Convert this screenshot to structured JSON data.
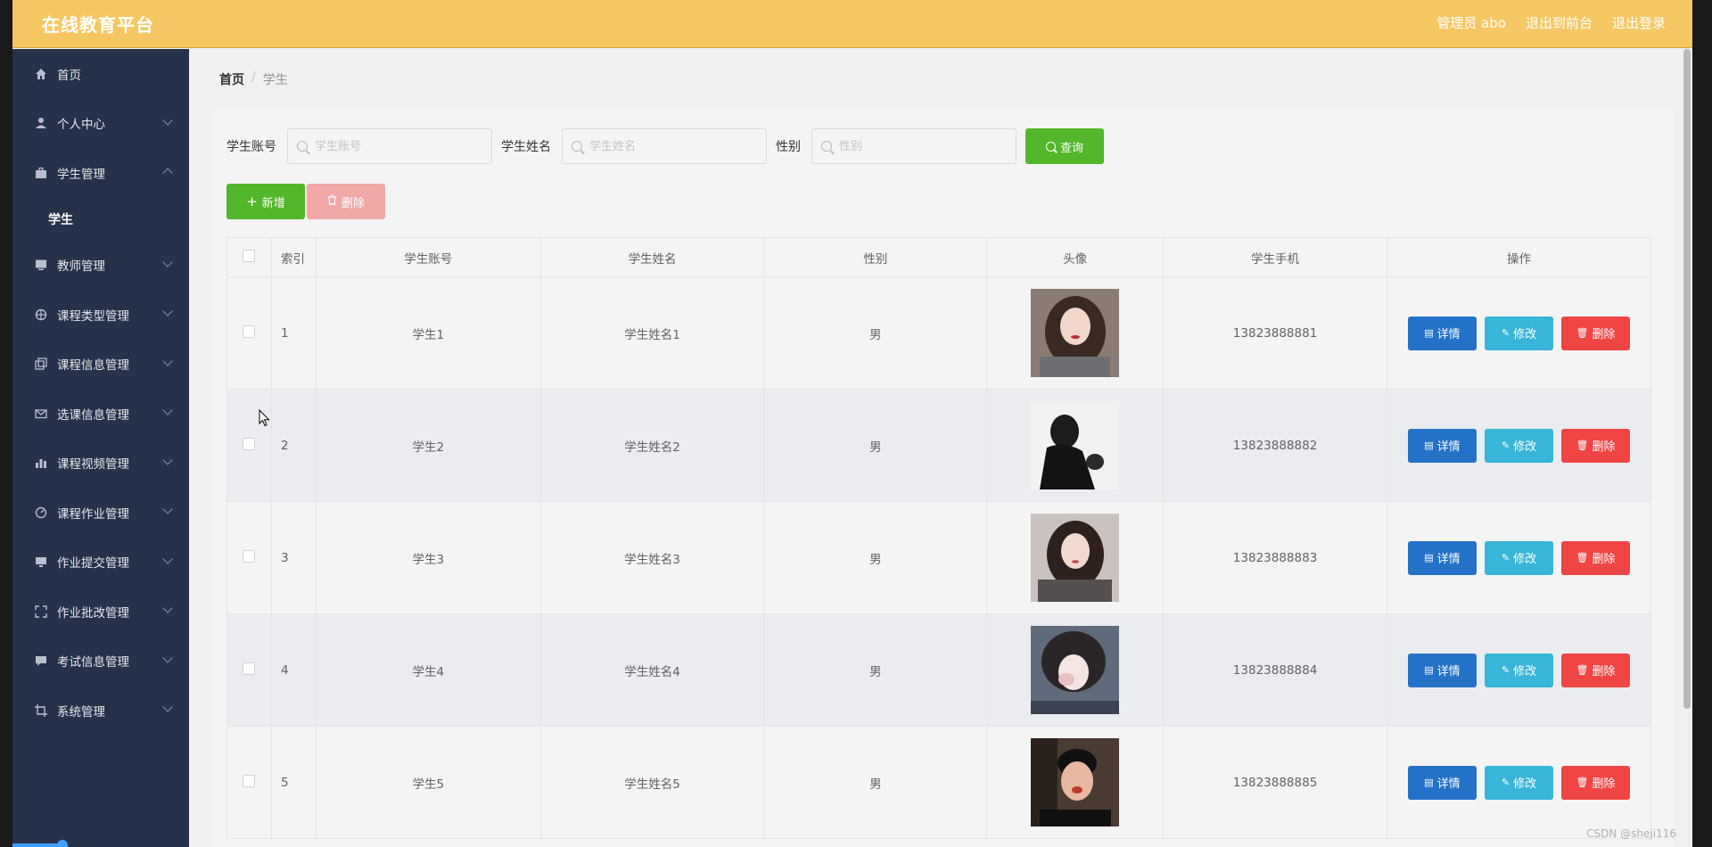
{
  "topbar": {
    "brand": "在线教育平台",
    "admin": "管理员 abo",
    "to_front": "退出到前台",
    "logout": "退出登录"
  },
  "sidebar": {
    "items": [
      {
        "label": "首页",
        "icon": "home-icon"
      },
      {
        "label": "个人中心",
        "icon": "user-icon"
      },
      {
        "label": "学生管理",
        "icon": "briefcase-icon"
      },
      {
        "label": "学生",
        "icon": ""
      },
      {
        "label": "教师管理",
        "icon": "monitor-icon"
      },
      {
        "label": "课程类型管理",
        "icon": "compass-icon"
      },
      {
        "label": "课程信息管理",
        "icon": "copy-icon"
      },
      {
        "label": "选课信息管理",
        "icon": "mail-icon"
      },
      {
        "label": "课程视频管理",
        "icon": "bar-chart-icon"
      },
      {
        "label": "课程作业管理",
        "icon": "gauge-icon"
      },
      {
        "label": "作业提交管理",
        "icon": "screen-icon"
      },
      {
        "label": "作业批改管理",
        "icon": "fullscreen-icon"
      },
      {
        "label": "考试信息管理",
        "icon": "message-icon"
      },
      {
        "label": "系统管理",
        "icon": "crop-icon"
      }
    ]
  },
  "breadcrumb": {
    "home": "首页",
    "sep": "/",
    "current": "学生"
  },
  "search": {
    "account_label": "学生账号",
    "account_placeholder": "学生账号",
    "name_label": "学生姓名",
    "name_placeholder": "学生姓名",
    "gender_label": "性别",
    "gender_placeholder": "性别",
    "query": "查询"
  },
  "actions": {
    "add": "新增",
    "delete": "删除"
  },
  "table": {
    "headers": [
      "索引",
      "学生账号",
      "学生姓名",
      "性别",
      "头像",
      "学生手机",
      "操作"
    ],
    "rows": [
      {
        "index": "1",
        "account": "学生1",
        "name": "学生姓名1",
        "gender": "男",
        "phone": "13823888881"
      },
      {
        "index": "2",
        "account": "学生2",
        "name": "学生姓名2",
        "gender": "男",
        "phone": "13823888882"
      },
      {
        "index": "3",
        "account": "学生3",
        "name": "学生姓名3",
        "gender": "男",
        "phone": "13823888883"
      },
      {
        "index": "4",
        "account": "学生4",
        "name": "学生姓名4",
        "gender": "男",
        "phone": "13823888884"
      },
      {
        "index": "5",
        "account": "学生5",
        "name": "学生姓名5",
        "gender": "男",
        "phone": "13823888885"
      }
    ],
    "op_detail": "详情",
    "op_edit": "修改",
    "op_delete": "删除"
  },
  "watermark": "CSDN @sheji116",
  "colors": {
    "topbar": "#f5c763",
    "sidebar": "#26324a",
    "green": "#52b72a",
    "detail": "#2472c8",
    "edit": "#38b5d8",
    "danger": "#f04545"
  }
}
